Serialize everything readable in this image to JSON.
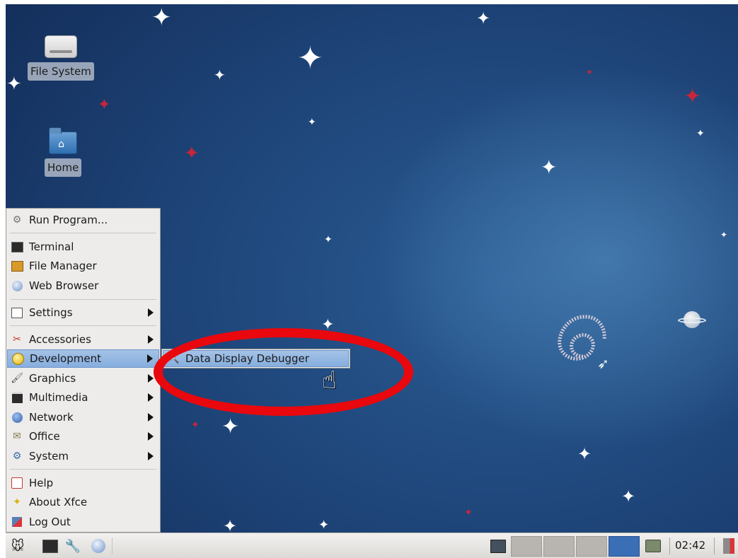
{
  "desktop": {
    "icons": [
      {
        "label": "File System",
        "icon": "drive-icon"
      },
      {
        "label": "Home",
        "icon": "home-folder-icon"
      }
    ]
  },
  "menu": {
    "items": [
      {
        "label": "Run Program...",
        "icon": "run-icon",
        "submenu": false
      },
      {
        "label": "Terminal",
        "icon": "terminal-icon",
        "submenu": false
      },
      {
        "label": "File Manager",
        "icon": "file-manager-icon",
        "submenu": false
      },
      {
        "label": "Web Browser",
        "icon": "globe-icon",
        "submenu": false
      },
      {
        "label": "Settings",
        "icon": "settings-icon",
        "submenu": true
      },
      {
        "label": "Accessories",
        "icon": "scissors-icon",
        "submenu": true
      },
      {
        "label": "Development",
        "icon": "development-icon",
        "submenu": true,
        "highlighted": true
      },
      {
        "label": "Graphics",
        "icon": "brush-icon",
        "submenu": true
      },
      {
        "label": "Multimedia",
        "icon": "clapper-icon",
        "submenu": true
      },
      {
        "label": "Network",
        "icon": "network-icon",
        "submenu": true
      },
      {
        "label": "Office",
        "icon": "office-icon",
        "submenu": true
      },
      {
        "label": "System",
        "icon": "system-gear-icon",
        "submenu": true
      },
      {
        "label": "Help",
        "icon": "help-icon",
        "submenu": false
      },
      {
        "label": "About Xfce",
        "icon": "star-icon",
        "submenu": false
      },
      {
        "label": "Log Out",
        "icon": "logout-icon",
        "submenu": false
      }
    ],
    "submenu": {
      "parent": "Development",
      "items": [
        {
          "label": "Data Display Debugger",
          "icon": "debugger-icon"
        }
      ]
    }
  },
  "taskbar": {
    "launchers": [
      "xfce-mouse-icon",
      "terminal-icon",
      "settings-icon",
      "globe-icon"
    ],
    "workspaces": 4,
    "active_workspace": 4,
    "clock": "02:42"
  },
  "colors": {
    "highlight": "#86aede",
    "annotation_ring": "#e8080d",
    "active_workspace": "#3a6fb6"
  }
}
